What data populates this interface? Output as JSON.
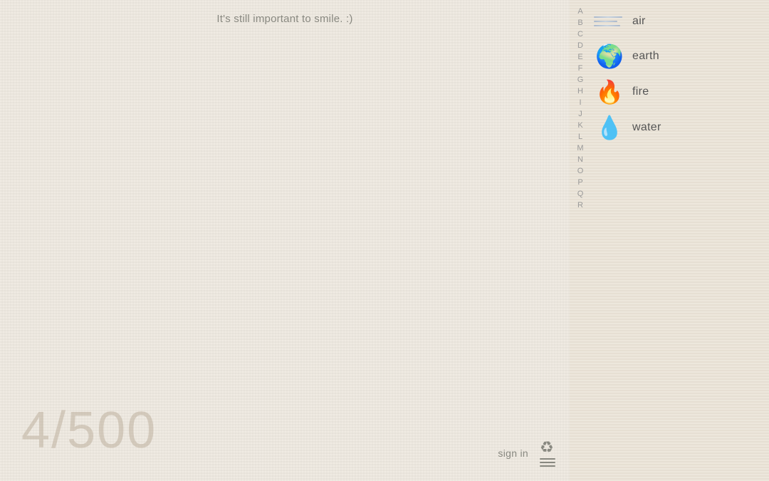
{
  "main": {
    "quote": "It's still important to smile. :)",
    "counter": "4/500",
    "sign_in_label": "sign in"
  },
  "alphabet": [
    "A",
    "B",
    "C",
    "D",
    "E",
    "F",
    "G",
    "H",
    "I",
    "J",
    "K",
    "L",
    "M",
    "N",
    "O",
    "P",
    "Q",
    "R"
  ],
  "elements": [
    {
      "id": "air",
      "name": "air",
      "type": "air",
      "emoji": ""
    },
    {
      "id": "earth",
      "name": "earth",
      "type": "emoji",
      "emoji": "🌍"
    },
    {
      "id": "fire",
      "name": "fire",
      "type": "emoji",
      "emoji": "🔥"
    },
    {
      "id": "water",
      "name": "water",
      "type": "emoji",
      "emoji": "💧"
    }
  ],
  "colors": {
    "background": "#f0ebe3",
    "sidebar_bg": "#ede7dc",
    "text_muted": "#888880",
    "counter_color": "rgba(180,165,145,0.45)"
  }
}
